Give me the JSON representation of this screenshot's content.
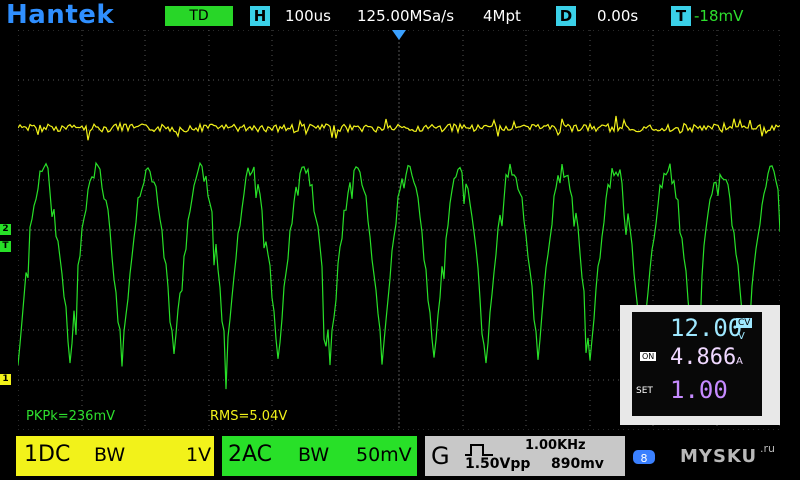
{
  "header": {
    "brand": "Hantek",
    "mode": "TD",
    "h_label": "H",
    "timebase": "100us",
    "sample_rate": "125.00MSa/s",
    "memory_depth": "4Mpt",
    "d_label": "D",
    "delay": "0.00s",
    "t_label": "T",
    "trigger_level": "-18mV"
  },
  "measurements": {
    "pkpk": "PKPk=236mV",
    "rms": "RMS=5.04V"
  },
  "channels": {
    "ch1": {
      "label": "1DC",
      "bw": "BW",
      "scale": "1V",
      "color": "#f2f21a"
    },
    "ch2": {
      "label": "2AC",
      "bw": "BW",
      "scale": "50mV",
      "color": "#28e028"
    }
  },
  "generator": {
    "label": "G",
    "frequency": "1.00KHz",
    "amplitude": "1.50Vpp",
    "offset": "890mv"
  },
  "markers": {
    "ch2": "2",
    "trigger": "T",
    "ch1": "1"
  },
  "inset_display": {
    "voltage": "12.00",
    "voltage_unit": "V",
    "cv": "CV",
    "on": "ON",
    "current": "4.866",
    "current_unit": "A",
    "set": "SET",
    "set_value": "1.00"
  },
  "watermark": "MYSKU",
  "watermark_suffix": ".ru"
}
